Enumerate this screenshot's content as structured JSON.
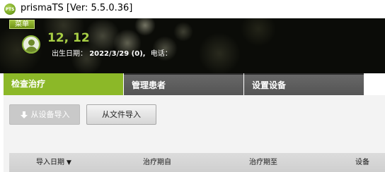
{
  "app": {
    "icon_text": "PTS",
    "title": "prismaTS [Ver: 5.5.0.36]"
  },
  "header": {
    "menu_label": "菜单",
    "patient_name": "12, 12",
    "dob_label": "出生日期：",
    "dob_value": "2022/3/29 (0),",
    "phone_label": "电话："
  },
  "tabs": [
    {
      "label": "检查治疗",
      "active": true
    },
    {
      "label": "管理患者",
      "active": false
    },
    {
      "label": "设置设备",
      "active": false
    }
  ],
  "toolbar": {
    "import_device_label": "从设备导入",
    "import_file_label": "从文件导入"
  },
  "table": {
    "columns": [
      {
        "label": "导入日期",
        "sort": "▼"
      },
      {
        "label": "治疗期自"
      },
      {
        "label": "治疗期至"
      },
      {
        "label": "设备"
      }
    ]
  },
  "colors": {
    "accent_green": "#8cb828",
    "header_dark": "#0b0c08",
    "tab_inactive": "#5e5e5e"
  }
}
